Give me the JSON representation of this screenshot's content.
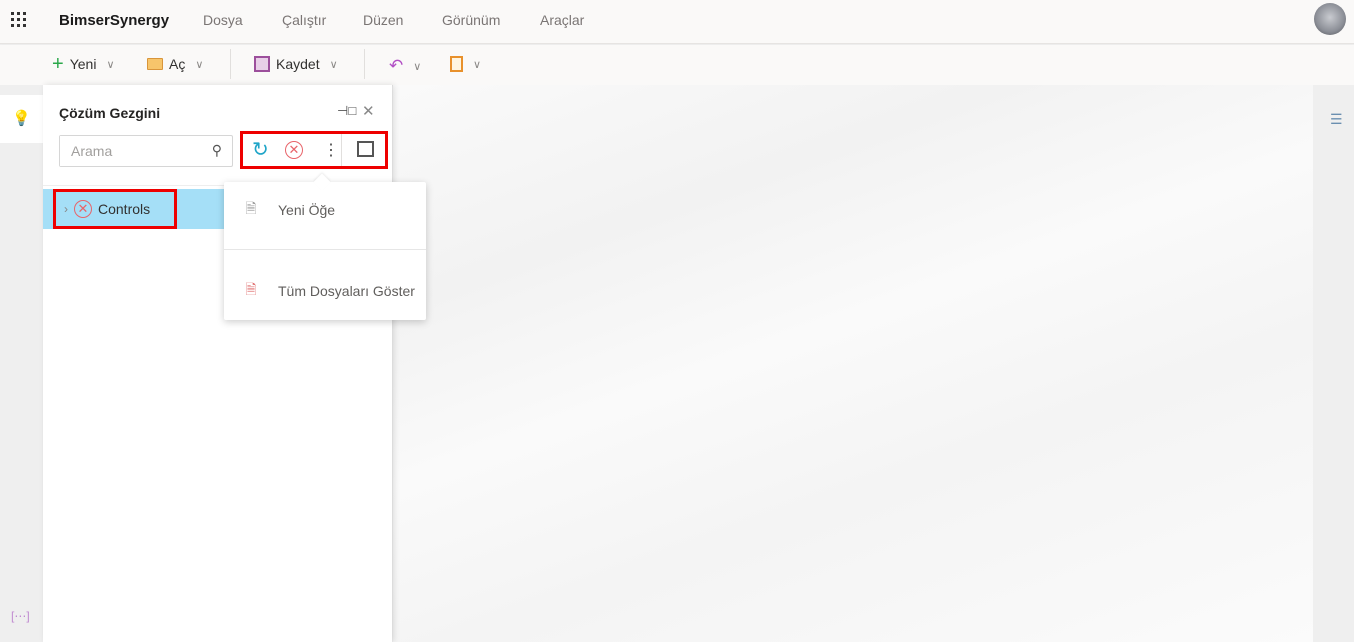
{
  "app": {
    "title": "BimserSynergy"
  },
  "menu": [
    "Dosya",
    "Çalıştır",
    "Düzen",
    "Görünüm",
    "Araçlar"
  ],
  "toolbar": {
    "new_label": "Yeni",
    "open_label": "Aç",
    "save_label": "Kaydet"
  },
  "panel": {
    "title": "Çözüm Gezgini",
    "search_placeholder": "Arama",
    "tree": [
      {
        "label": "Controls"
      }
    ]
  },
  "dropdown": {
    "items": [
      {
        "label": "Yeni Öğe"
      },
      {
        "label": "Tüm Dosyaları Göster"
      }
    ]
  },
  "colors": {
    "highlight": "#e00000",
    "selected_row": "#a5dff7",
    "accent": "#1fa5c8"
  }
}
